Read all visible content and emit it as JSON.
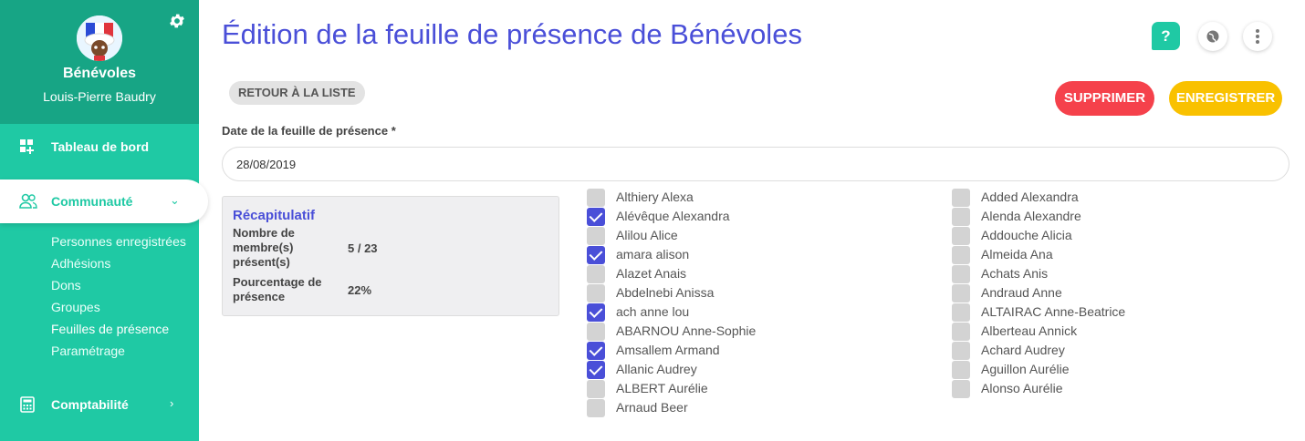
{
  "sidebar": {
    "org_name": "Bénévoles",
    "user_name": "Louis-Pierre Baudry",
    "nav": {
      "dashboard": "Tableau de bord",
      "community": "Communauté",
      "accounting": "Comptabilité"
    },
    "sub_items": [
      "Personnes enregistrées",
      "Adhésions",
      "Dons",
      "Groupes",
      "Feuilles de présence",
      "Paramétrage"
    ]
  },
  "header": {
    "title": "Édition de la feuille de présence de Bénévoles",
    "help_label": "?"
  },
  "actions": {
    "back": "RETOUR À LA LISTE",
    "delete": "SUPPRIMER",
    "save": "ENREGISTRER"
  },
  "form": {
    "date_label": "Date de la feuille de présence *",
    "date_value": "28/08/2019"
  },
  "recap": {
    "title": "Récapitulatif",
    "count_label": "Nombre de membre(s) présent(s)",
    "count_value": "5 / 23",
    "pct_label": "Pourcentage de présence",
    "pct_value": "22%"
  },
  "members_left": [
    {
      "name": "Althiery Alexa",
      "checked": false
    },
    {
      "name": "Alévêque Alexandra",
      "checked": true
    },
    {
      "name": "Alilou Alice",
      "checked": false
    },
    {
      "name": "amara alison",
      "checked": true
    },
    {
      "name": "Alazet Anais",
      "checked": false
    },
    {
      "name": "Abdelnebi Anissa",
      "checked": false
    },
    {
      "name": "ach anne lou",
      "checked": true
    },
    {
      "name": "ABARNOU Anne-Sophie",
      "checked": false
    },
    {
      "name": "Amsallem Armand",
      "checked": true
    },
    {
      "name": "Allanic Audrey",
      "checked": true
    },
    {
      "name": "ALBERT Aurélie",
      "checked": false
    },
    {
      "name": "Arnaud Beer",
      "checked": false
    }
  ],
  "members_right": [
    {
      "name": "Added Alexandra",
      "checked": false
    },
    {
      "name": "Alenda Alexandre",
      "checked": false
    },
    {
      "name": "Addouche Alicia",
      "checked": false
    },
    {
      "name": "Almeida Ana",
      "checked": false
    },
    {
      "name": "Achats Anis",
      "checked": false
    },
    {
      "name": "Andraud Anne",
      "checked": false
    },
    {
      "name": "ALTAIRAC Anne-Beatrice",
      "checked": false
    },
    {
      "name": "Alberteau Annick",
      "checked": false
    },
    {
      "name": "Achard Audrey",
      "checked": false
    },
    {
      "name": "Aguillon Aurélie",
      "checked": false
    },
    {
      "name": "Alonso Aurélie",
      "checked": false
    }
  ],
  "colors": {
    "sidebar": "#1fc9a4",
    "sidebar_header": "#17a585",
    "accent": "#4a4fd8",
    "delete": "#f5414b",
    "save": "#f9c100"
  }
}
